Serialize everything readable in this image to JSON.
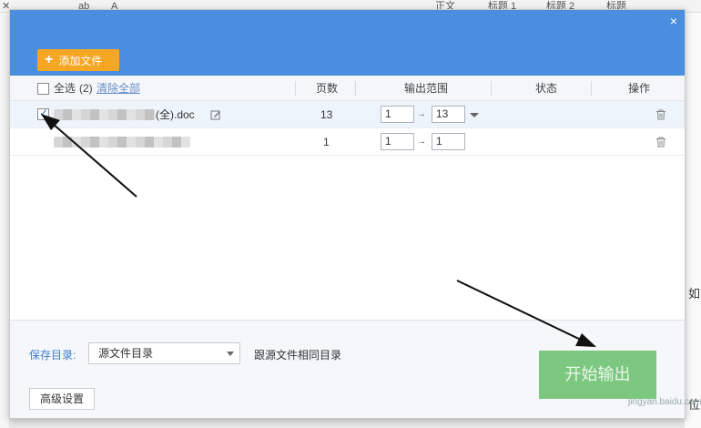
{
  "ribbon": {
    "items": [
      {
        "text": "✕"
      },
      {
        "text": "ab"
      },
      {
        "text": "A"
      },
      {
        "text": "正文"
      },
      {
        "text": "标题 1"
      },
      {
        "text": "标题 2"
      },
      {
        "text": "标题"
      }
    ]
  },
  "background_text": [
    "如",
    "位"
  ],
  "dialog": {
    "close_label": "×",
    "add_button": {
      "plus": "+",
      "label": "添加文件"
    }
  },
  "table": {
    "select_all": "全选",
    "count": "(2)",
    "clear_all": "清除全部",
    "headers": {
      "pages": "页数",
      "range": "输出范围",
      "status": "状态",
      "action": "操作"
    },
    "rows": [
      {
        "checked": true,
        "name_suffix": "(全).doc",
        "pages": "13",
        "from": "1",
        "to": "13",
        "arrow": "→"
      },
      {
        "checked": false,
        "name_suffix": "",
        "pages": "1",
        "from": "1",
        "to": "1",
        "arrow": "→"
      }
    ]
  },
  "footer": {
    "save_label": "保存目录:",
    "save_option": "源文件目录",
    "same_dir_text": "跟源文件相同目录",
    "advanced_button": "高级设置",
    "start_button": "开始输出"
  },
  "watermark": "jingyan.baidu.com",
  "colors": {
    "header": "#4a8fdf",
    "add_button": "#f5a623",
    "start_button": "#7cc880",
    "link": "#6b8fc7",
    "save_label": "#3f7ccf"
  }
}
